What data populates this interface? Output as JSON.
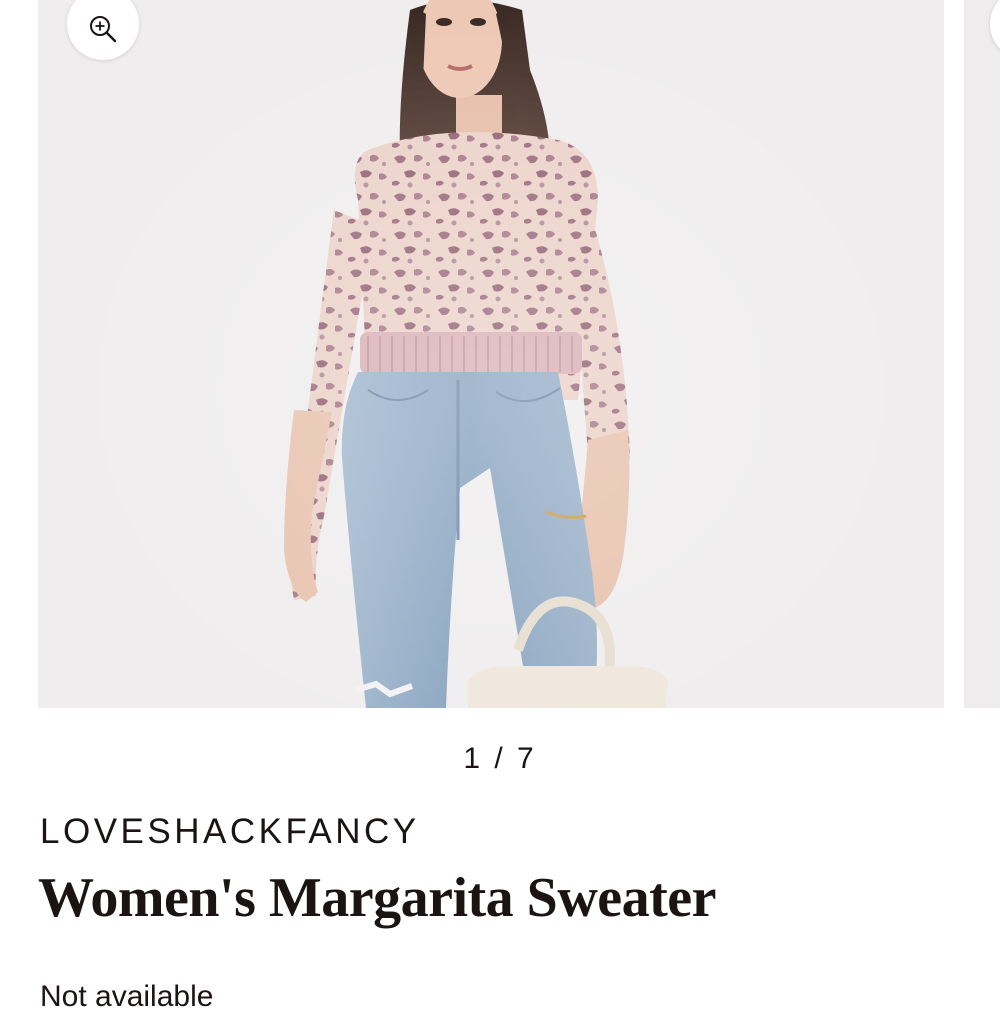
{
  "gallery": {
    "current_slide": 1,
    "total_slides": 7,
    "counter_text": "1 / 7",
    "zoom_icon": "zoom-in-icon"
  },
  "product": {
    "brand": "LOVESHACKFANCY",
    "title": "Women's Margarita Sweater",
    "availability": "Not available"
  },
  "colors": {
    "image_background": "#efeded",
    "sweater_base": "#e9cfc6",
    "leopard_spots": "#9c6c7e",
    "denim": "#8aa6c2",
    "text": "#1a1414"
  }
}
